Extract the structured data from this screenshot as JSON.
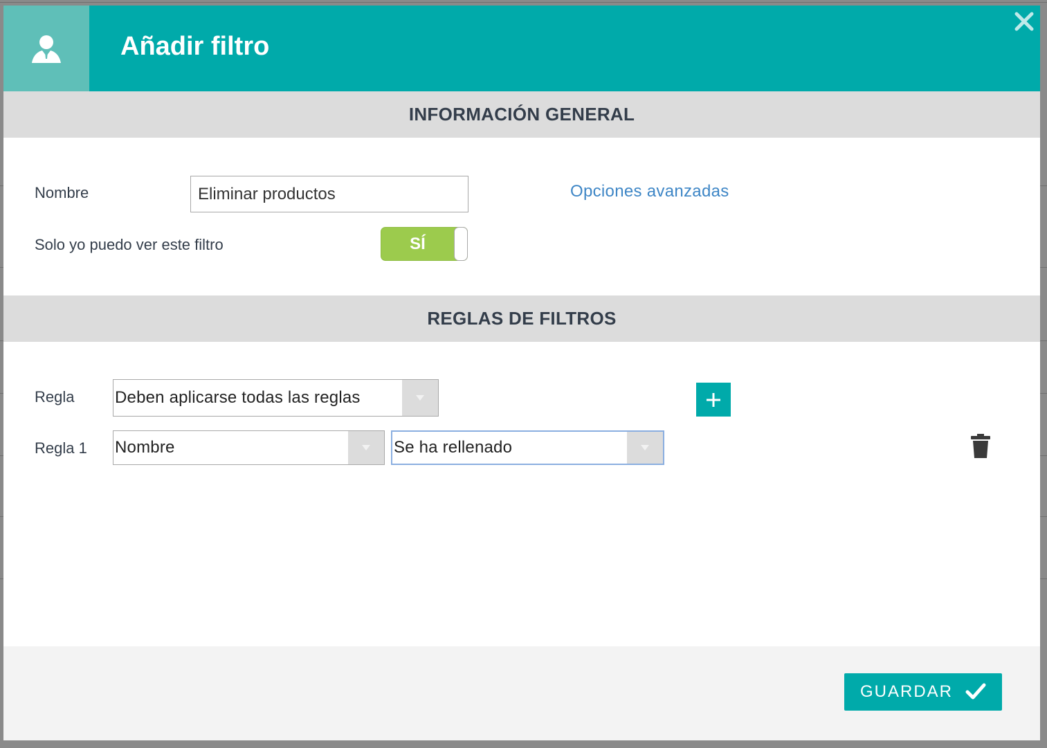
{
  "dialog": {
    "title": "Añadir filtro",
    "header_icon": "user-icon",
    "close_icon": "close-icon"
  },
  "general_section": {
    "title": "INFORMACIÓN GENERAL",
    "name_label": "Nombre",
    "name_value": "Eliminar productos",
    "advanced_link": "Opciones avanzadas",
    "private_label": "Solo yo puedo ver este filtro",
    "private_toggle": {
      "label": "SÍ",
      "state": "on"
    }
  },
  "rules_section": {
    "title": "REGLAS DE FILTROS",
    "rule_label": "Regla",
    "rule_mode": "Deben aplicarse todas las reglas",
    "add_rule_icon": "plus-icon",
    "rules": [
      {
        "label": "Regla 1",
        "field": "Nombre",
        "condition": "Se ha rellenado",
        "delete_icon": "trash-icon"
      }
    ]
  },
  "footer": {
    "save_label": "GUARDAR",
    "save_icon": "check-icon"
  },
  "colors": {
    "accent": "#00aaaa",
    "header_icon_bg": "#5fbfb8",
    "section_bar": "#dcdcdc",
    "toggle_on": "#9ccb4d",
    "link": "#3e86c6",
    "text": "#333d4a"
  }
}
